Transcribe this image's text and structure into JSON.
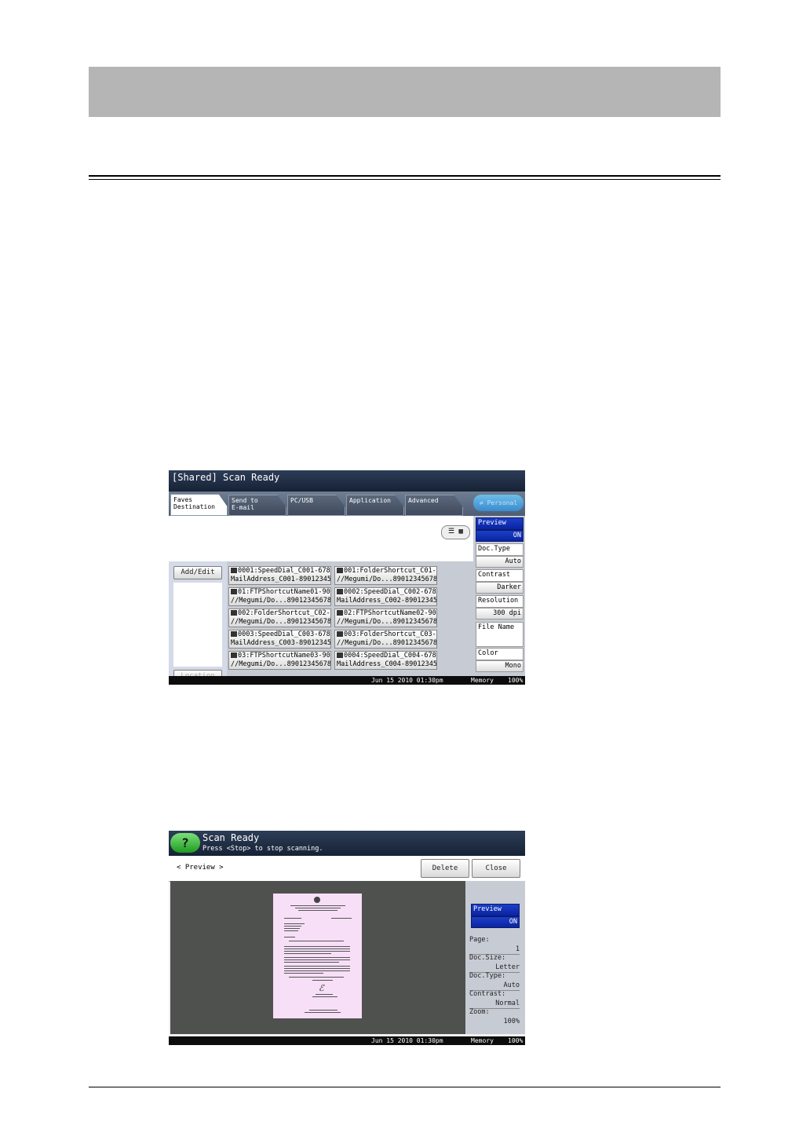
{
  "screen1": {
    "title": "[Shared] Scan Ready",
    "tabs": [
      {
        "label": "Faves\nDestination",
        "active": true
      },
      {
        "label": "Send to\nE-mail",
        "active": false
      },
      {
        "label": "PC/USB",
        "active": false
      },
      {
        "label": "Application",
        "active": false
      },
      {
        "label": "Advanced",
        "active": false
      }
    ],
    "personal_button": "Personal",
    "view_toggle_icons": [
      "list-view-icon",
      "grid-view-icon"
    ],
    "add_edit_button": "Add/Edit",
    "location_button": "Location",
    "destinations": [
      {
        "icon": "email-icon",
        "line1": "0001:SpeedDial_C001-678",
        "line2": "MailAddress_C001-89012345"
      },
      {
        "icon": "folder-icon",
        "line1": "001:FolderShortcut_C01-",
        "line2": "//Megumi/Do...89012345678"
      },
      {
        "icon": "ftp-icon",
        "line1": "01:FTPShortcutName01-90",
        "line2": "//Megumi/Do...89012345678"
      },
      {
        "icon": "email-icon",
        "line1": "0002:SpeedDial_C002-678",
        "line2": "MailAddress_C002-89012345"
      },
      {
        "icon": "folder-icon",
        "line1": "002:FolderShortcut_C02-",
        "line2": "//Megumi/Do...89012345678"
      },
      {
        "icon": "ftp-icon",
        "line1": "02:FTPShortcutName02-90",
        "line2": "//Megumi/Do...89012345678"
      },
      {
        "icon": "email-icon",
        "line1": "0003:SpeedDial_C003-678",
        "line2": "MailAddress_C003-89012345"
      },
      {
        "icon": "folder-icon",
        "line1": "003:FolderShortcut_C03-",
        "line2": "//Megumi/Do...89012345678"
      },
      {
        "icon": "ftp-icon",
        "line1": "03:FTPShortcutName03-90",
        "line2": "//Megumi/Do...89012345678"
      },
      {
        "icon": "email-icon",
        "line1": "0004:SpeedDial_C004-678",
        "line2": "MailAddress_C004-89012345"
      }
    ],
    "settings": [
      {
        "label": "Preview",
        "value": "ON",
        "selected": true
      },
      {
        "label": "Doc.Type",
        "value": "Auto",
        "selected": false
      },
      {
        "label": "Contrast",
        "value": "Darker",
        "selected": false
      },
      {
        "label": "Resolution",
        "value": "300 dpi",
        "selected": false
      },
      {
        "label": "File Name",
        "value": "",
        "selected": false
      },
      {
        "label": "Color",
        "value": "Mono",
        "selected": false
      }
    ],
    "status": {
      "datetime": "Jun 15 2010 01:30pm",
      "memory_label": "Memory",
      "memory_value": "100%"
    }
  },
  "screen2": {
    "title": "Scan Ready",
    "subtitle": "Press <Stop> to stop scanning.",
    "help_label": "?",
    "preview_heading": "< Preview >",
    "delete_button": "Delete",
    "close_button": "Close",
    "preview_toggle": {
      "label": "Preview",
      "value": "ON"
    },
    "info": [
      {
        "label": "Page:",
        "value": "1"
      },
      {
        "label": "Doc.Size:",
        "value": "Letter"
      },
      {
        "label": "Doc.Type:",
        "value": "Auto"
      },
      {
        "label": "Contrast:",
        "value": "Normal"
      },
      {
        "label": "Zoom:",
        "value": "100%"
      }
    ],
    "status": {
      "datetime": "Jun 15 2010 01:30pm",
      "memory_label": "Memory",
      "memory_value": "100%"
    }
  }
}
